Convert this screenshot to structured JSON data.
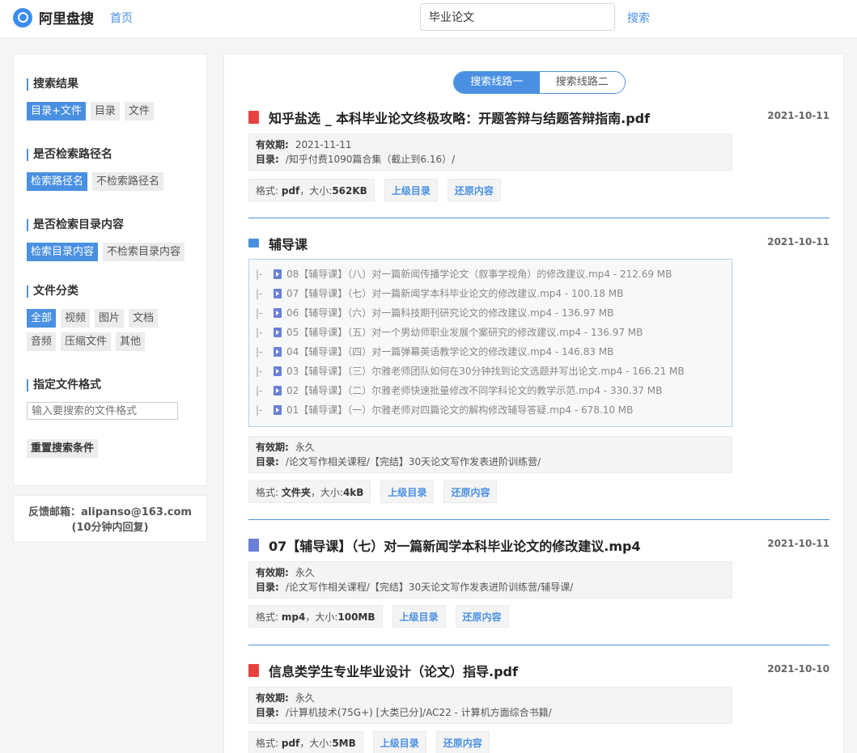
{
  "header": {
    "logo_text": "阿里盘搜",
    "home_label": "首页",
    "search_value": "毕业论文",
    "search_label": "搜索"
  },
  "sidebar": {
    "sections": [
      {
        "title": "搜索结果",
        "options": [
          {
            "label": "目录+文件",
            "active": true
          },
          {
            "label": "目录",
            "active": false
          },
          {
            "label": "文件",
            "active": false
          }
        ]
      },
      {
        "title": "是否检索路径名",
        "options": [
          {
            "label": "检索路径名",
            "active": true
          },
          {
            "label": "不检索路径名",
            "active": false
          }
        ]
      },
      {
        "title": "是否检索目录内容",
        "options": [
          {
            "label": "检索目录内容",
            "active": true
          },
          {
            "label": "不检索目录内容",
            "active": false
          }
        ]
      },
      {
        "title": "文件分类",
        "options": [
          {
            "label": "全部",
            "active": true
          },
          {
            "label": "视频",
            "active": false
          },
          {
            "label": "图片",
            "active": false
          },
          {
            "label": "文档",
            "active": false
          },
          {
            "label": "音频",
            "active": false
          },
          {
            "label": "压缩文件",
            "active": false
          },
          {
            "label": "其他",
            "active": false
          }
        ]
      }
    ],
    "format_title": "指定文件格式",
    "format_placeholder": "输入要搜索的文件格式",
    "reset_label": "重置搜索条件"
  },
  "feedback": {
    "line1": "反馈邮箱：alipanso@163.com",
    "line2": "(10分钟内回复)"
  },
  "routes": [
    {
      "label": "搜索线路一",
      "active": true
    },
    {
      "label": "搜索线路二",
      "active": false
    }
  ],
  "labels": {
    "validity": "有效期:",
    "directory": "目录:",
    "format": "格式:",
    "size_sep": "，大小:",
    "parent_dir": "上级目录",
    "restore": "还原内容"
  },
  "results": [
    {
      "type": "pdf",
      "title": "知乎盐选 _ 本科毕业论文终极攻略：开题答辩与结题答辩指南.pdf",
      "date": "2021-10-11",
      "validity": "2021-11-11",
      "directory": "/知乎付费1090篇合集（截止到6.16）/",
      "format": "pdf",
      "size": "562KB"
    },
    {
      "type": "folder",
      "title": "辅导课",
      "date": "2021-10-11",
      "validity": "永久",
      "directory": "/论文写作相关课程/【完结】30天论文写作发表进阶训练营/",
      "format": "文件夹",
      "size": "4kB",
      "children": [
        "08【辅导课】（八）对一篇新闻传播学论文（叙事学视角）的修改建议.mp4  - 212.69 MB",
        "07【辅导课】（七）对一篇新闻学本科毕业论文的修改建议.mp4  - 100.18 MB",
        "06【辅导课】（六）对一篇科技期刊研究论文的修改建议.mp4  - 136.97 MB",
        "05【辅导课】（五）对一个男幼师职业发展个案研究的修改建议.mp4  - 136.97 MB",
        "04【辅导课】（四）对一篇弹幕英语教学论文的修改建议.mp4  - 146.83 MB",
        "03【辅导课】（三）尔雅老师团队如何在30分钟找到论文选题并写出论文.mp4  - 166.21 MB",
        "02【辅导课】（二）尔雅老师快速批量修改不同学科论文的教学示范.mp4  - 330.37 MB",
        "01【辅导课】（一）尔雅老师对四篇论文的解构修改辅导答疑.mp4  - 678.10 MB"
      ]
    },
    {
      "type": "mp4",
      "title": "07【辅导课】（七）对一篇新闻学本科毕业论文的修改建议.mp4",
      "date": "2021-10-11",
      "validity": "永久",
      "directory": "/论文写作相关课程/【完结】30天论文写作发表进阶训练营/辅导课/",
      "format": "mp4",
      "size": "100MB"
    },
    {
      "type": "pdf",
      "title": "信息类学生专业毕业设计（论文）指导.pdf",
      "date": "2021-10-10",
      "validity": "永久",
      "directory": "/计算机技术(75G+) [大类已分]/AC22 - 计算机方面综合书籍/",
      "format": "pdf",
      "size": "5MB"
    }
  ]
}
